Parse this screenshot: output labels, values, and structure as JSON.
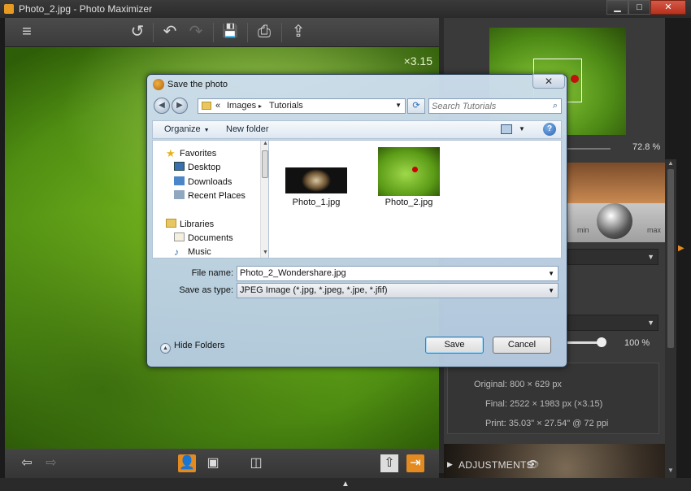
{
  "window": {
    "title": "Photo_2.jpg - Photo Maximizer",
    "min_glyph": "▁",
    "max_glyph": "□",
    "close_glyph": "✕"
  },
  "toolbar": {
    "menu_glyph": "≡",
    "rotate_glyph": "↺",
    "undo_glyph": "↶",
    "redo_glyph": "↷",
    "save_glyph": "💾",
    "print_glyph": "⎙",
    "export_glyph": "⇪"
  },
  "canvas": {
    "zoom_label": "×3.15"
  },
  "bottombar": {
    "prev_glyph": "⇦",
    "next_glyph": "⇨",
    "person_glyph": "👤",
    "compare_glyph": "▣",
    "split_glyph": "◫",
    "upload_glyph": "⇧",
    "exit_glyph": "⇥",
    "collapse_glyph": "▲"
  },
  "right_panel": {
    "navigator_zoom": "72.8 %",
    "preset_min": "min",
    "preset_max": "max",
    "slider_value": "100 %",
    "info": {
      "original": "Original: 800 × 629 px",
      "final": "Final: 2522 × 1983 px (×3.15)",
      "print": "Print: 35.03\" × 27.54\" @ 72 ppi"
    },
    "adjustments_label": "ADJUSTMENTS",
    "adjustments_chevron": "▶",
    "eye_glyph": "👁"
  },
  "dialog": {
    "title": "Save the photo",
    "close_glyph": "✕",
    "back_glyph": "◀",
    "forward_glyph": "▶",
    "address": {
      "separator": "«",
      "crumbs": [
        "Images",
        "Tutorials"
      ],
      "crumb_arrow": "▸"
    },
    "refresh_glyph": "⟳",
    "search_placeholder": "Search Tutorials",
    "search_glyph": "⌕",
    "commands": {
      "organize": "Organize",
      "new_folder": "New folder",
      "help": "?"
    },
    "nav": {
      "favorites": "Favorites",
      "desktop": "Desktop",
      "downloads": "Downloads",
      "recent_places": "Recent Places",
      "libraries": "Libraries",
      "documents": "Documents",
      "music": "Music"
    },
    "files": [
      {
        "name": "Photo_1.jpg"
      },
      {
        "name": "Photo_2.jpg"
      }
    ],
    "form": {
      "file_name_label": "File name:",
      "file_name_value": "Photo_2_Wondershare.jpg",
      "save_type_label": "Save as type:",
      "save_type_value": "JPEG Image (*.jpg, *.jpeg, *.jpe, *.jfif)"
    },
    "hide_folders": "Hide Folders",
    "save_button": "Save",
    "cancel_button": "Cancel"
  },
  "colors": {
    "accent_orange": "#e38a20",
    "dialog_glass": "#c3d6ea",
    "canvas_green": "#7fbf22"
  }
}
